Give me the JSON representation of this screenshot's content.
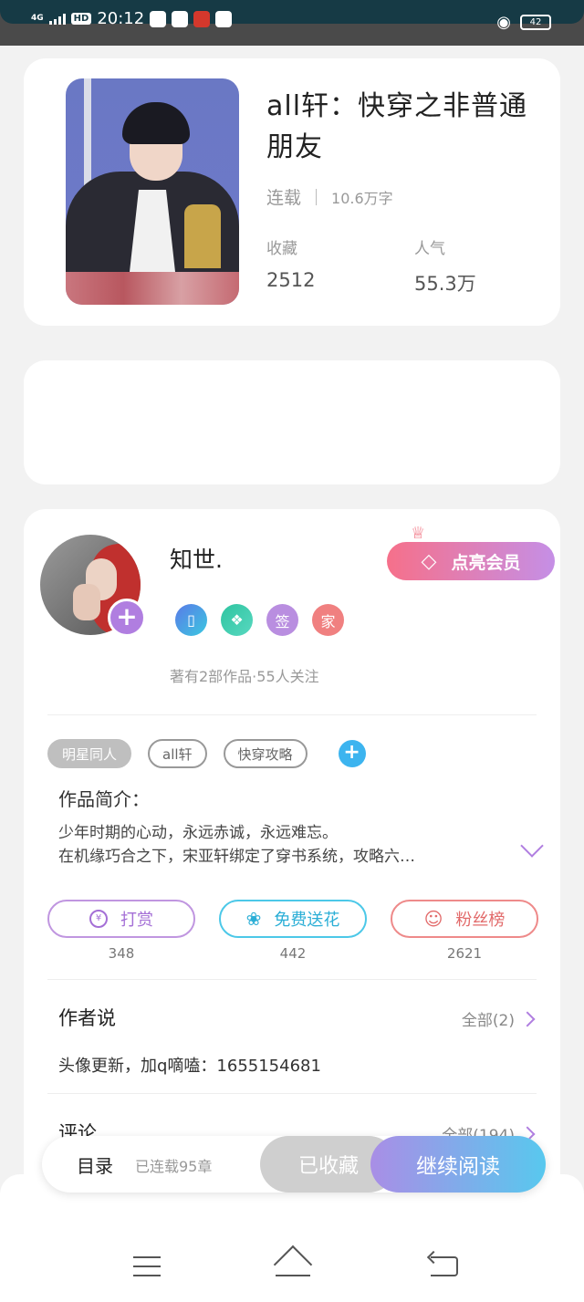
{
  "status_bar": {
    "network": "4G",
    "hd": "HD",
    "time": "20:12",
    "battery": "42"
  },
  "book": {
    "title": "all轩：快穿之非普通朋友",
    "status": "连载",
    "word_count": "10.6万字",
    "favorites_label": "收藏",
    "favorites_value": "2512",
    "popularity_label": "人气",
    "popularity_value": "55.3万"
  },
  "author": {
    "name": "知世.",
    "info": "著有2部作品·55人关注",
    "vip_button": "点亮会员",
    "badges": [
      "phone-badge-icon",
      "handshake-badge-icon",
      "签",
      "家"
    ]
  },
  "tags": [
    "明星同人",
    "all轩",
    "快穿攻略"
  ],
  "intro": {
    "title": "作品简介：",
    "lines": [
      "少年时期的心动，永远赤诚，永远难忘。",
      "在机缘巧合之下，宋亚轩绑定了穿书系统，攻略六…"
    ]
  },
  "actions": [
    {
      "label": "打赏",
      "count": "348"
    },
    {
      "label": "免费送花",
      "count": "442"
    },
    {
      "label": "粉丝榜",
      "count": "2621"
    }
  ],
  "author_says": {
    "title": "作者说",
    "more": "全部(2)",
    "content": "头像更新，加q嘀嗑：1655154681"
  },
  "comments": {
    "title": "评论",
    "more": "全部(194)"
  },
  "bottom_bar": {
    "catalog": "目录",
    "chapters": "已连载95章",
    "favorited": "已收藏",
    "continue_reading": "继续阅读"
  },
  "colors": {
    "accent_purple": "#b07ee0",
    "accent_blue": "#58c8ee",
    "vip_pink": "#f6708a"
  }
}
